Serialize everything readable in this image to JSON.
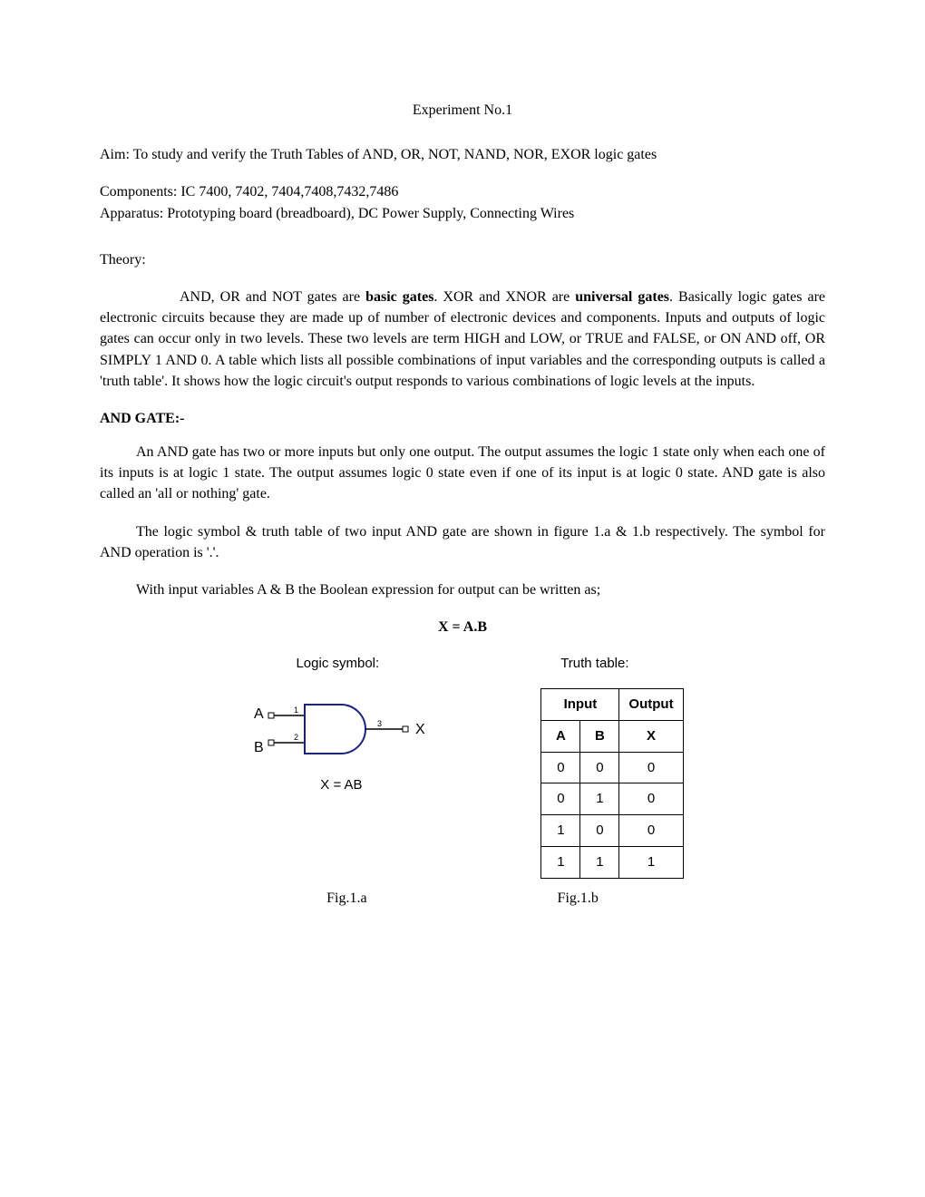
{
  "title": "Experiment No.1",
  "aim": "Aim: To study and verify the Truth Tables of AND, OR, NOT, NAND, NOR, EXOR logic gates",
  "components": "Components: IC 7400, 7402, 7404,7408,7432,7486",
  "apparatus": "Apparatus: Prototyping board (breadboard), DC Power Supply, Connecting Wires",
  "theory_label": "Theory:",
  "theory": {
    "pre1": "AND, OR and NOT gates are ",
    "b1": "basic gates",
    "mid1": ". XOR and XNOR are ",
    "b2": "universal gates",
    "post1": ". Basically logic gates are electronic circuits because they are made up of number of electronic devices and components. Inputs and outputs of logic gates can occur only in two levels. These two levels are term HIGH and LOW, or TRUE and FALSE, or ON AND off, OR SIMPLY 1 AND 0. A table which lists all possible combinations of input variables and the corresponding outputs is called a 'truth table'. It shows how the logic circuit's output responds to various combinations of logic levels at the inputs."
  },
  "and_gate_heading": "AND GATE:-",
  "and_para1": "An AND gate has two or more inputs but only one output. The output assumes the logic 1 state only when each one of its inputs is at logic 1 state. The output assumes logic 0 state even if one of its input is at logic 0 state. AND gate is also called an 'all or nothing' gate.",
  "and_para2": "The logic symbol & truth table of two input AND gate are shown in figure 1.a & 1.b respectively. The symbol for AND operation is '.'.",
  "and_para3": "With input variables A & B the Boolean expression for output can be written as;",
  "equation": "X = A.B",
  "labels": {
    "logic_symbol": "Logic symbol:",
    "truth_table": "Truth table:"
  },
  "gate": {
    "inA": "A",
    "inB": "B",
    "out": "X",
    "pin1": "1",
    "pin2": "2",
    "pin3": "3",
    "expr": "X = AB"
  },
  "truth": {
    "head_input": "Input",
    "head_output": "Output",
    "colA": "A",
    "colB": "B",
    "colX": "X",
    "rows": [
      {
        "a": "0",
        "b": "0",
        "x": "0"
      },
      {
        "a": "0",
        "b": "1",
        "x": "0"
      },
      {
        "a": "1",
        "b": "0",
        "x": "0"
      },
      {
        "a": "1",
        "b": "1",
        "x": "1"
      }
    ]
  },
  "fig_a": "Fig.1.a",
  "fig_b": "Fig.1.b"
}
